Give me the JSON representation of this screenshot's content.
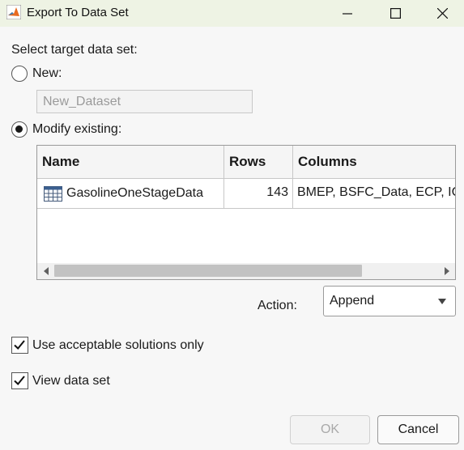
{
  "window": {
    "title": "Export To Data Set",
    "app_icon": "matlab-icon",
    "titlebar_color": "#eef3e4",
    "controls": [
      "minimize-icon",
      "maximize-icon",
      "close-icon"
    ]
  },
  "target": {
    "prompt": "Select target data set:",
    "new_option": {
      "label": "New:",
      "selected": false
    },
    "new_name_value": "New_Dataset",
    "modify_option": {
      "label": "Modify existing:",
      "selected": true
    }
  },
  "table": {
    "columns": [
      "Name",
      "Rows",
      "Columns"
    ],
    "rows": [
      {
        "icon": "table-grid-icon",
        "name": "GasolineOneStageData",
        "rows": "143",
        "columns": "BMEP, BSFC_Data, ECP, IC"
      }
    ]
  },
  "action": {
    "label": "Action:",
    "selected": "Append"
  },
  "options": {
    "acceptable_only": {
      "label": "Use acceptable solutions only",
      "checked": true
    },
    "view_data_set": {
      "label": "View data set",
      "checked": true
    }
  },
  "buttons": {
    "ok": "OK",
    "cancel": "Cancel"
  }
}
